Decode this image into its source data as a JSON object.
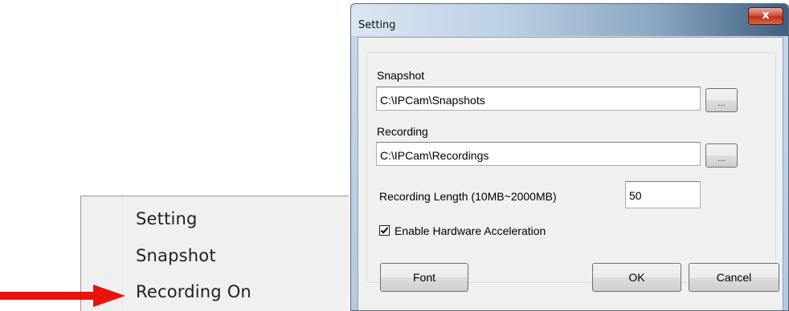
{
  "context_menu": {
    "items": [
      {
        "label": "Setting"
      },
      {
        "label": "Snapshot"
      },
      {
        "label": "Recording On"
      }
    ]
  },
  "annotation": {
    "arrow_color": "#e8140c"
  },
  "dialog": {
    "title": "Setting",
    "close_glyph": "x",
    "snapshot": {
      "label": "Snapshot",
      "path_value": "C:\\IPCam\\Snapshots",
      "browse_label": "..."
    },
    "recording": {
      "label": "Recording",
      "path_value": "C:\\IPCam\\Recordings",
      "browse_label": "..."
    },
    "recording_length": {
      "label": "Recording Length (10MB~2000MB)",
      "value": "50"
    },
    "hardware_acceleration": {
      "label": "Enable Hardware Acceleration",
      "checked": true
    },
    "buttons": {
      "font": "Font",
      "ok": "OK",
      "cancel": "Cancel"
    }
  }
}
